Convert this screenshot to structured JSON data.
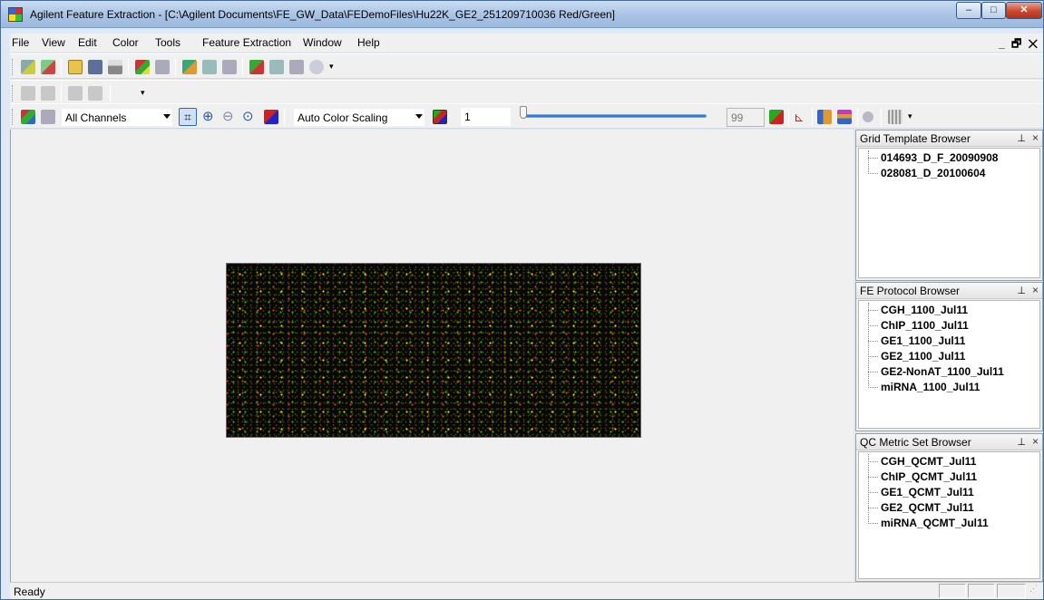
{
  "window": {
    "title": "Agilent Feature Extraction - [C:\\Agilent Documents\\FE_GW_Data\\FEDemoFiles\\Hu22K_GE2_251209710036 Red/Green]",
    "controls": {
      "minimize": "–",
      "maximize": "□",
      "close": "✕"
    }
  },
  "menubar": {
    "items": [
      "File",
      "View",
      "Edit",
      "Color",
      "Tools",
      "Feature Extraction",
      "Window",
      "Help"
    ],
    "mdi_controls": "_ 🗗 ✕"
  },
  "toolbar3": {
    "channel_select": "All Channels",
    "color_scaling_select": "Auto Color Scaling",
    "threshold_value": "1",
    "slider_max_value": "99"
  },
  "panels": {
    "grid_template": {
      "title": "Grid Template Browser",
      "items": [
        "014693_D_F_20090908",
        "028081_D_20100604"
      ]
    },
    "fe_protocol": {
      "title": "FE Protocol Browser",
      "items": [
        "CGH_1100_Jul11",
        "ChIP_1100_Jul11",
        "GE1_1100_Jul11",
        "GE2_1100_Jul11",
        "GE2-NonAT_1100_Jul11",
        "miRNA_1100_Jul11"
      ]
    },
    "qc_metric": {
      "title": "QC Metric Set Browser",
      "items": [
        "CGH_QCMT_Jul11",
        "ChIP_QCMT_Jul11",
        "GE1_QCMT_Jul11",
        "GE2_QCMT_Jul11",
        "miRNA_QCMT_Jul11"
      ]
    },
    "pin_glyph": "⊥",
    "close_glyph": "×"
  },
  "statusbar": {
    "text": "Ready"
  },
  "colors": {
    "titlebar": "#a9c3e4",
    "slider_track": "#2b7fd4",
    "close_button": "#c8492e",
    "array_background": "#080806"
  }
}
